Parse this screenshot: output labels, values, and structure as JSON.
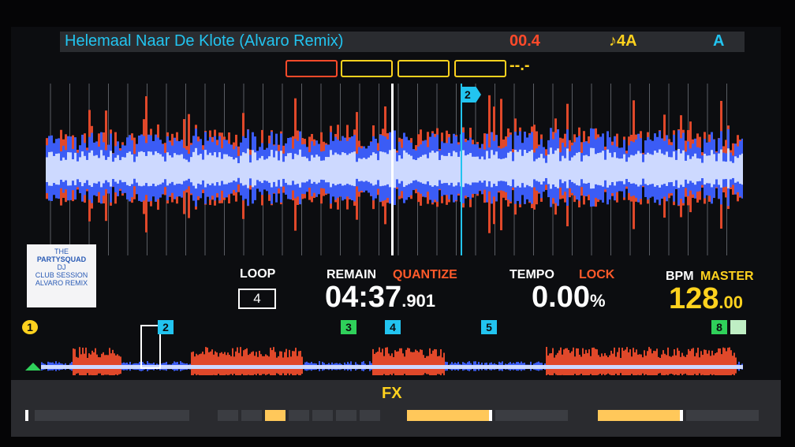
{
  "header": {
    "track_title": "Helemaal Naar De Klote (Alvaro Remix)",
    "elapsed": "00.4",
    "key": "♪4A",
    "deck": "A"
  },
  "beat_jump": {
    "dash": "--.-"
  },
  "waveform": {
    "hot_cue": "2"
  },
  "artwork": {
    "lines": [
      "THE",
      "PARTYSQUAD",
      "DJ",
      "CLUB SESSION",
      "",
      "ALVARO REMIX"
    ]
  },
  "loop": {
    "label": "LOOP",
    "value": "4"
  },
  "remain": {
    "label": "REMAIN",
    "quantize_label": "QUANTIZE",
    "time_main": "04:37",
    "time_ms": ".901"
  },
  "tempo": {
    "label": "TEMPO",
    "lock_label": "LOCK",
    "value_main": "0.00",
    "unit": "%"
  },
  "bpm": {
    "label": "BPM",
    "master_label": "MASTER",
    "value_main": "128",
    "value_dec": ".00"
  },
  "overview_cues": [
    {
      "id": "1",
      "color": "#ffd21e",
      "type": "memory"
    },
    {
      "id": "2",
      "color": "#22c4f0",
      "type": "hot"
    },
    {
      "id": "3",
      "color": "#2fd05a",
      "type": "hot"
    },
    {
      "id": "4",
      "color": "#22c4f0",
      "type": "hot"
    },
    {
      "id": "5",
      "color": "#22c4f0",
      "type": "hot"
    },
    {
      "id": "8",
      "color": "#2fd05a",
      "type": "hot"
    }
  ],
  "fx": {
    "label": "FX"
  },
  "colors": {
    "accent_cyan": "#22c4f0",
    "accent_yellow": "#ffd21e",
    "accent_red": "#ff4a2a",
    "wave_blue": "#2f4ff0",
    "wave_white": "#c8d8ff"
  }
}
